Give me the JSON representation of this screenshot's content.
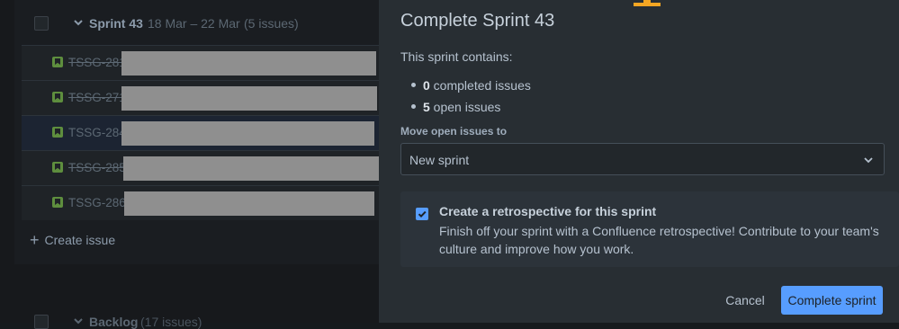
{
  "board": {
    "sprint": {
      "name": "Sprint 43",
      "dates": "18 Mar – 22 Mar",
      "count": "(5 issues)"
    },
    "issues": [
      {
        "key": "TSSG-281",
        "done": true
      },
      {
        "key": "TSSG-271",
        "done": true
      },
      {
        "key": "TSSG-284",
        "done": false
      },
      {
        "key": "TSSG-285",
        "done": true
      },
      {
        "key": "TSSG-286",
        "done": false
      }
    ],
    "create_issue": "Create issue",
    "backlog": {
      "name": "Backlog",
      "count": "(17 issues)"
    }
  },
  "modal": {
    "title": "Complete Sprint 43",
    "contains_label": "This sprint contains:",
    "completed_count": "0",
    "completed_label": " completed issues",
    "open_count": "5",
    "open_label": " open issues",
    "move_label": "Move open issues to",
    "move_value": "New sprint",
    "retro_checked": true,
    "retro_title": "Create a retrospective for this sprint",
    "retro_desc": "Finish off your sprint with a Confluence retrospective! Contribute to your team's culture and improve how you work.",
    "cancel_label": "Cancel",
    "complete_label": "Complete sprint"
  },
  "colors": {
    "accent": "#579dff",
    "story": "#5e8e3e",
    "top_indicator": "#f5a623"
  },
  "icons": [
    "chevron-down-icon",
    "story-icon",
    "plus-icon",
    "checkmark-icon"
  ]
}
